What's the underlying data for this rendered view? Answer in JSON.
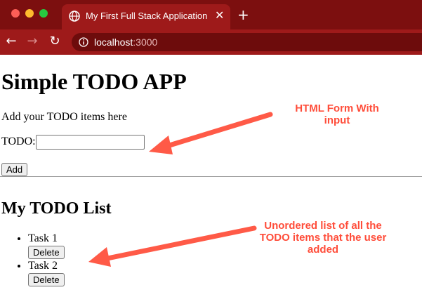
{
  "browser": {
    "tab_title": "My First Full Stack Application",
    "tab_close": "✕",
    "new_tab": "+",
    "url_host": "localhost",
    "url_port": ":3000",
    "nav_back": "←",
    "nav_forward": "→",
    "nav_reload": "↻",
    "frame_color": "#8a1414"
  },
  "page": {
    "title": "Simple TODO APP",
    "intro": "Add your TODO items here",
    "todo_label": "TODO:",
    "todo_input_value": "",
    "add_button": "Add",
    "list_heading": "My TODO List",
    "items": [
      {
        "label": "Task 1",
        "delete": "Delete"
      },
      {
        "label": "Task 2",
        "delete": "Delete"
      }
    ]
  },
  "annotations": {
    "form_note": "HTML Form With input",
    "list_note": "Unordered list of all the TODO items that the user added",
    "color": "#ff4d3a"
  }
}
